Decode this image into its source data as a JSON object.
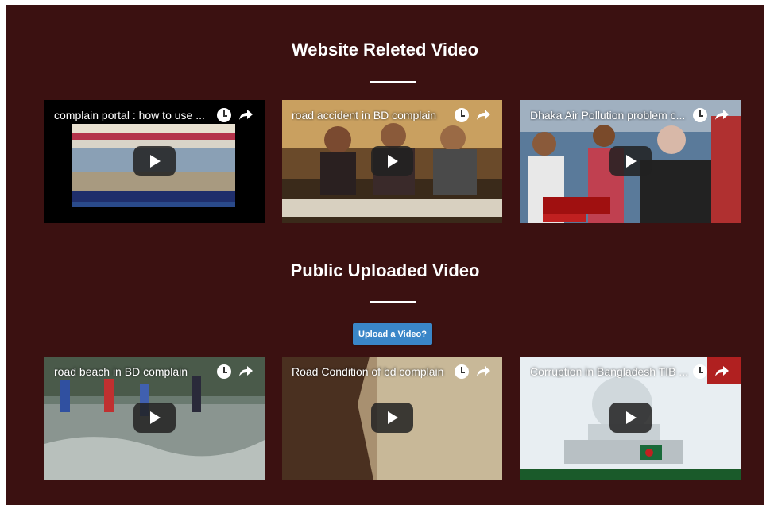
{
  "sections": {
    "website_title": "Website Releted Video",
    "public_title": "Public Uploaded Video",
    "upload_button": "Upload a Video?"
  },
  "website_videos": [
    {
      "title": "complain portal : how to use ..."
    },
    {
      "title": "road accident in BD complain"
    },
    {
      "title": "Dhaka Air Pollution problem c..."
    }
  ],
  "public_videos": [
    {
      "title": "road beach in BD complain"
    },
    {
      "title": "Road Condition of bd complain"
    },
    {
      "title": "Corruption in Bangladesh TIB ..."
    }
  ],
  "colors": {
    "background": "#3b1111",
    "button": "#3a86c8",
    "text": "#ffffff"
  }
}
